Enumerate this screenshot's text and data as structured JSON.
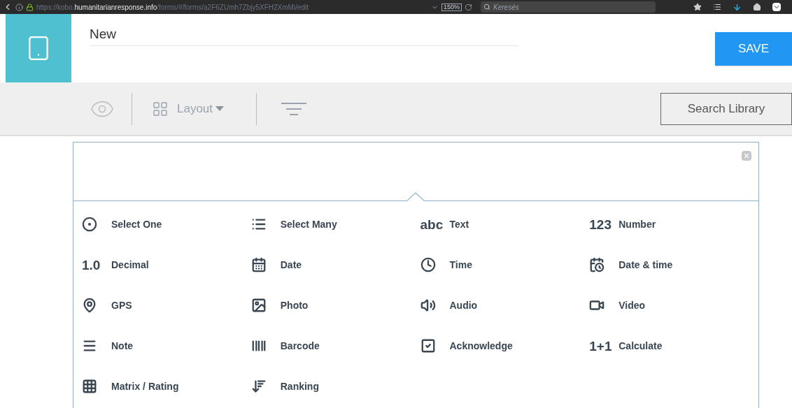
{
  "browser": {
    "url": {
      "prefix": "https://kobo.",
      "domain": "humanitarianresponse.info",
      "path": "/forms/#/forms/a2F6ZUmh7Zbjy5XFH2XmMi/edit"
    },
    "zoom": "150%",
    "search": {
      "placeholder": "Keresés"
    }
  },
  "header": {
    "title": "New",
    "save": "SAVE"
  },
  "toolbar": {
    "layout": "Layout",
    "search_library": "Search Library"
  },
  "question_types": [
    {
      "label": "Select One",
      "kind": "icon"
    },
    {
      "label": "Select Many",
      "kind": "icon"
    },
    {
      "label": "Text",
      "kind": "glyph",
      "glyph": "abc"
    },
    {
      "label": "Number",
      "kind": "glyph",
      "glyph": "123"
    },
    {
      "label": "Decimal",
      "kind": "glyph",
      "glyph": "1.0"
    },
    {
      "label": "Date",
      "kind": "icon"
    },
    {
      "label": "Time",
      "kind": "icon"
    },
    {
      "label": "Date & time",
      "kind": "icon"
    },
    {
      "label": "GPS",
      "kind": "icon"
    },
    {
      "label": "Photo",
      "kind": "icon"
    },
    {
      "label": "Audio",
      "kind": "icon"
    },
    {
      "label": "Video",
      "kind": "icon"
    },
    {
      "label": "Note",
      "kind": "icon"
    },
    {
      "label": "Barcode",
      "kind": "icon"
    },
    {
      "label": "Acknowledge",
      "kind": "icon"
    },
    {
      "label": "Calculate",
      "kind": "glyph",
      "glyph": "1+1"
    },
    {
      "label": "Matrix / Rating",
      "kind": "icon"
    },
    {
      "label": "Ranking",
      "kind": "icon"
    }
  ]
}
